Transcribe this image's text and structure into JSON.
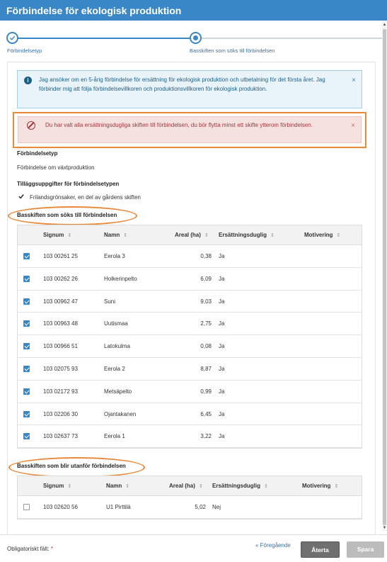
{
  "window": {
    "title": "Förbindelse för ekologisk produktion"
  },
  "stepper": {
    "steps": [
      {
        "label": "Förbindelsetyp",
        "state": "done"
      },
      {
        "label": "Basskiften som söks till förbindelsen",
        "state": "active"
      }
    ]
  },
  "info_alert": {
    "text": "Jag ansöker om en 5-årig förbindelse för ersättning för ekologisk produktion och utbetalning för det första året. Jag förbinder mig att följa förbindelsevillkoren och produktionsvillkoren för ekologisk produktion.",
    "close": "×",
    "icon": "info-icon"
  },
  "error_alert": {
    "text": "Du har valt alla ersättningsdugliga skiften till förbindelsen, du bör flytta minst ett skifte ytterom förbindelsen.",
    "close": "×",
    "icon": "prohibited-icon"
  },
  "commitment_type": {
    "heading": "Förbindelsetyp",
    "value": "Förbindelse om växtproduktion"
  },
  "additional": {
    "heading": "Tilläggsuppgifter för förbindelsetypen",
    "items": [
      "Frilandsgrönsaker, en del av gårdens skiften"
    ]
  },
  "included": {
    "heading": "Basskiften som söks till förbindelsen",
    "columns": [
      "Signum",
      "Namn",
      "Areal (ha)",
      "Ersättningsduglig",
      "Motivering"
    ],
    "sort_glyph": "⇕",
    "rows": [
      {
        "checked": true,
        "signum": "103 00261 25",
        "name": "Eerola 3",
        "area": "0,38",
        "eligible": "Ja"
      },
      {
        "checked": true,
        "signum": "103 00262 26",
        "name": "Holkerinpelto",
        "area": "6,09",
        "eligible": "Ja"
      },
      {
        "checked": true,
        "signum": "103 00962 47",
        "name": "Suni",
        "area": "9,03",
        "eligible": "Ja"
      },
      {
        "checked": true,
        "signum": "103 00963 48",
        "name": "Uutismaa",
        "area": "2,75",
        "eligible": "Ja"
      },
      {
        "checked": true,
        "signum": "103 00966 51",
        "name": "Latokulma",
        "area": "0,08",
        "eligible": "Ja"
      },
      {
        "checked": true,
        "signum": "103 02075 93",
        "name": "Eerola 2",
        "area": "8,87",
        "eligible": "Ja"
      },
      {
        "checked": true,
        "signum": "103 02172 93",
        "name": "Metsäpelto",
        "area": "0,99",
        "eligible": "Ja"
      },
      {
        "checked": true,
        "signum": "103 02206 30",
        "name": "Ojantakanen",
        "area": "6,45",
        "eligible": "Ja"
      },
      {
        "checked": true,
        "signum": "103 02637 73",
        "name": "Eerola 1",
        "area": "3,22",
        "eligible": "Ja"
      }
    ]
  },
  "excluded": {
    "heading": "Basskiften som blir utanför förbindelsen",
    "columns": [
      "Signum",
      "Namn",
      "Areal (ha)",
      "Ersättningsduglig",
      "Motivering"
    ],
    "rows": [
      {
        "checked": false,
        "signum": "103 02620 56",
        "name": "U1 Pirttilä",
        "area": "5,02",
        "eligible": "Nej"
      }
    ]
  },
  "footer": {
    "required_label": "Obligatoriskt fält:",
    "required_star": "*",
    "prev_link": "« Föregående",
    "back_button": "Återta",
    "save_button": "Spara"
  },
  "colors": {
    "accent": "#3a87c8",
    "highlight": "#e8893a",
    "error": "#a4343a"
  }
}
